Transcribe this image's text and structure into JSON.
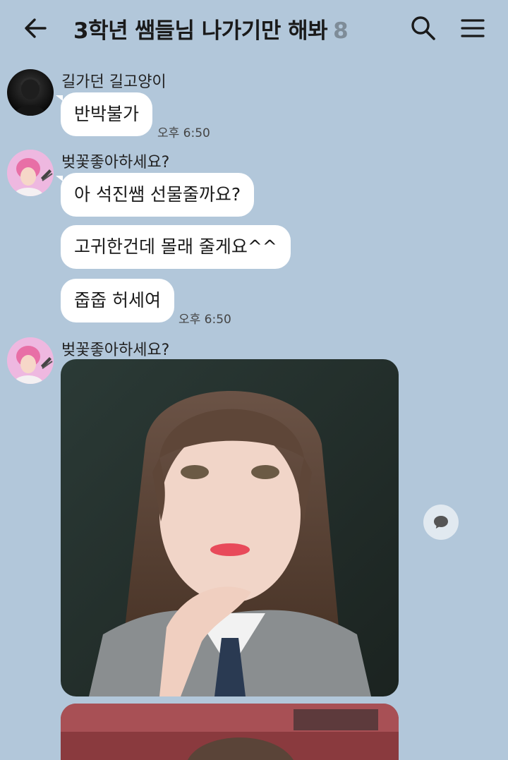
{
  "header": {
    "title": "3학년 쌤들님 나가기만 해봐",
    "member_count": "8",
    "back_icon": "arrow-left-icon",
    "search_icon": "search-icon",
    "menu_icon": "hamburger-menu-icon"
  },
  "messages": [
    {
      "sender": "길가던 길고양이",
      "bubbles": [
        "반박불가"
      ],
      "time": "오후 6:50"
    },
    {
      "sender": "벚꽃좋아하세요?",
      "bubbles": [
        "아 석진쌤 선물줄까요?",
        "고귀한건데 몰래 줄게요^^",
        "줍줍 허세여"
      ],
      "time": "오후 6:50"
    },
    {
      "sender": "벚꽃좋아하세요?",
      "photos": [
        "photo-portrait-1",
        "photo-portrait-2"
      ]
    }
  ],
  "colors": {
    "background": "#b2c7da",
    "bubble": "#ffffff",
    "member_count": "#7e8c98"
  }
}
